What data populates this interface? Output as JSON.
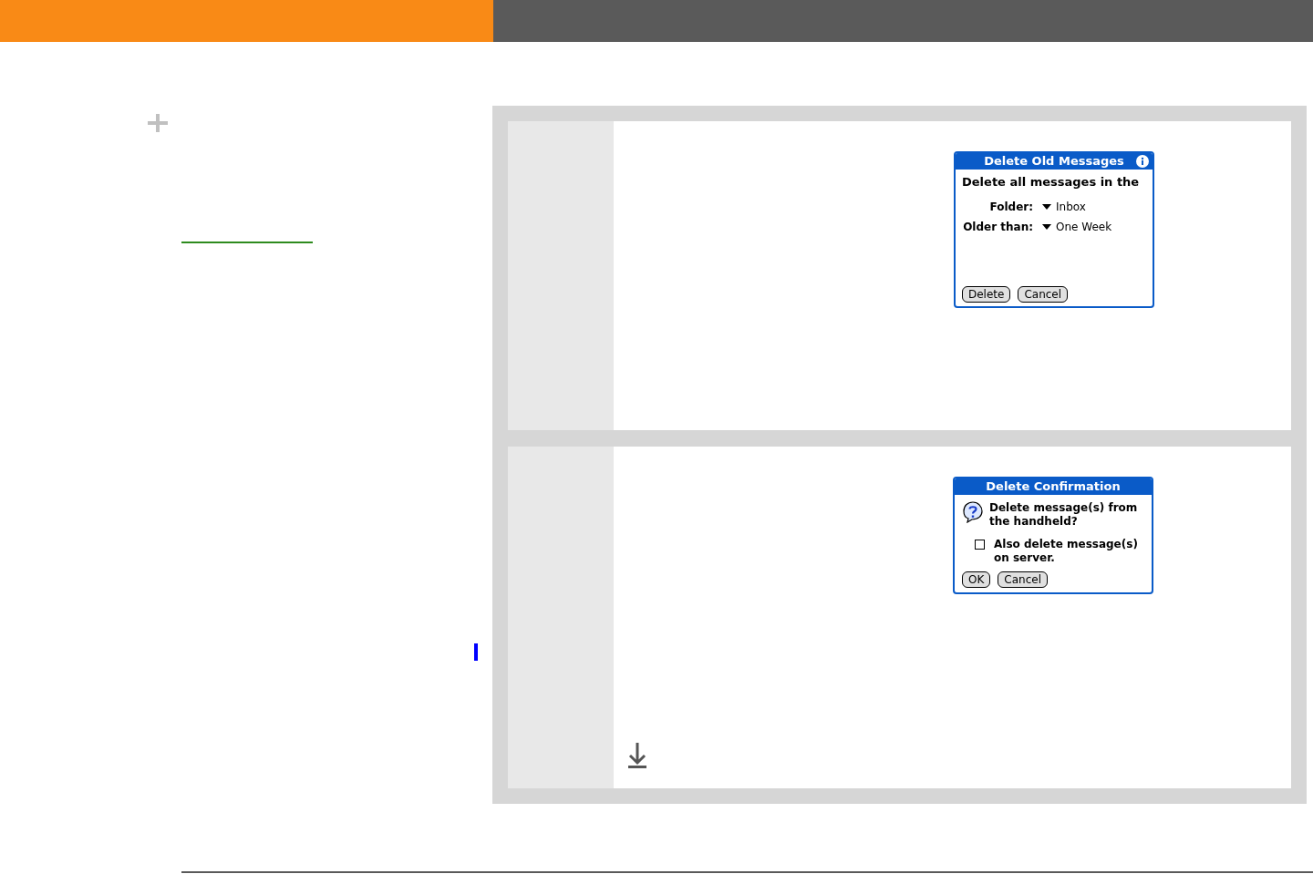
{
  "dialogs": [
    {
      "kind": "options",
      "title": "Delete Old Messages",
      "heading": "Delete all messages in the",
      "fields": [
        {
          "label": "Folder:",
          "value": "Inbox"
        },
        {
          "label": "Older than:",
          "value": "One Week"
        }
      ],
      "buttons": [
        "Delete",
        "Cancel"
      ]
    },
    {
      "kind": "confirm",
      "title": "Delete Confirmation",
      "question": "Delete message(s) from the handheld?",
      "checkbox": {
        "label": "Also delete message(s) on server.",
        "checked": false
      },
      "buttons": [
        "OK",
        "Cancel"
      ]
    }
  ]
}
